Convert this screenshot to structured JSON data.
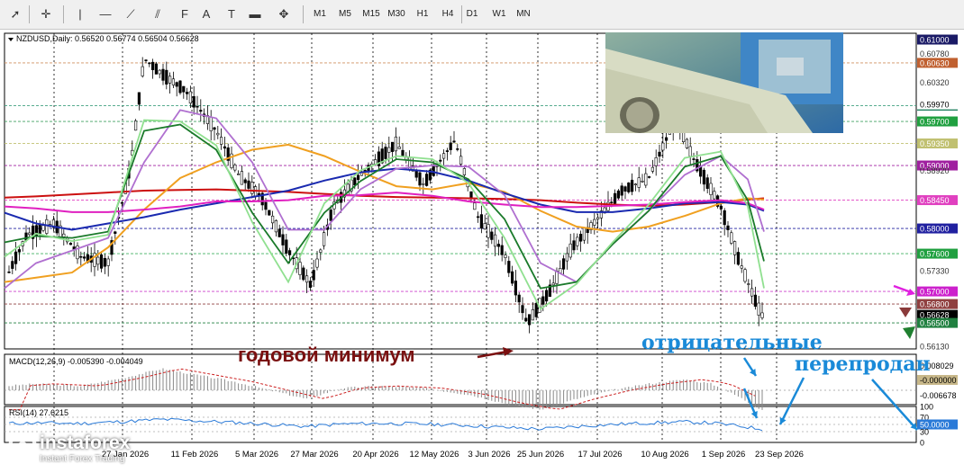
{
  "toolbar": {
    "timeframes": [
      "M1",
      "M5",
      "M15",
      "M30",
      "H1",
      "H4",
      "D1",
      "W1",
      "MN"
    ],
    "tools": [
      {
        "icon": "cursor-icon",
        "glyph": "➚"
      },
      {
        "icon": "crosshair-icon",
        "glyph": "✛"
      },
      {
        "icon": "vertical-line-icon",
        "glyph": "|"
      },
      {
        "icon": "horizontal-line-icon",
        "glyph": "—"
      },
      {
        "icon": "trendline-icon",
        "glyph": "⟋"
      },
      {
        "icon": "equidistant-channel-icon",
        "glyph": "⫽"
      },
      {
        "icon": "fibonacci-icon",
        "glyph": "F"
      },
      {
        "icon": "text-icon",
        "glyph": "A"
      },
      {
        "icon": "text-label-icon",
        "glyph": "T"
      },
      {
        "icon": "rectangle-label-icon",
        "glyph": "▬"
      },
      {
        "icon": "arrows-shapes-icon",
        "glyph": "✥"
      }
    ]
  },
  "chart_data": [
    {
      "type": "candlestick",
      "title": "NZDUSD,Daily:  0.56520 0.56774 0.56504 0.56628",
      "ylim": [
        0.5613,
        0.61
      ],
      "x_tick_labels": [
        "27 Jan 2026",
        "11 Feb 2026",
        "5 Mar 2026",
        "27 Mar 2026",
        "20 Apr 2026",
        "12 May 2026",
        "3 Jun 2026",
        "25 Jun 2026",
        "17 Jul 2026",
        "10 Aug 2026",
        "1 Sep 2026",
        "23 Sep 2026"
      ],
      "price_levels": [
        {
          "label": "0.61000",
          "price": 0.61,
          "bg": "#1a1a66",
          "line": null
        },
        {
          "label": "0.60780",
          "price": 0.6078,
          "bg": null,
          "line": null
        },
        {
          "label": "0.60630",
          "price": 0.6063,
          "bg": "#c06030",
          "line": "#d09060"
        },
        {
          "label": "0.60320",
          "price": 0.6032,
          "bg": null,
          "line": null
        },
        {
          "label": "0.59950",
          "price": 0.5995,
          "bg": "#208060",
          "line": "#40a080"
        },
        {
          "label": "0.59970",
          "price": 0.5997,
          "bg": "#ffffff",
          "line": null
        },
        {
          "label": "0.59700",
          "price": 0.597,
          "bg": "#20a040",
          "line": "#40a060"
        },
        {
          "label": "0.59350",
          "price": 0.5935,
          "bg": "#c0c070",
          "line": "#c0c070"
        },
        {
          "label": "0.59000",
          "price": 0.59,
          "bg": "#a020a0",
          "line": "#a020a0"
        },
        {
          "label": "0.58920",
          "price": 0.5892,
          "bg": null,
          "line": null
        },
        {
          "label": "0.58450",
          "price": 0.5845,
          "bg": "#e040c0",
          "line": "#e040c0"
        },
        {
          "label": "0.58000",
          "price": 0.58,
          "bg": "#2020a0",
          "line": "#2020a0"
        },
        {
          "label": "0.57600",
          "price": 0.576,
          "bg": "#20a040",
          "line": "#40b060"
        },
        {
          "label": "0.57330",
          "price": 0.5733,
          "bg": null,
          "line": null
        },
        {
          "label": "0.57000",
          "price": 0.57,
          "bg": "#cc20cc",
          "line": "#cc40cc"
        },
        {
          "label": "0.56800",
          "price": 0.568,
          "bg": "#904040",
          "line": "#904040"
        },
        {
          "label": "0.56628",
          "price": 0.56628,
          "bg": "#000000",
          "line": null
        },
        {
          "label": "0.56500",
          "price": 0.565,
          "bg": "#208040",
          "line": "#208040"
        },
        {
          "label": "0.56130",
          "price": 0.5613,
          "bg": null,
          "line": null
        }
      ],
      "moving_averages": [
        {
          "color": "#cc1010",
          "values": [
            0.5849,
            0.5851,
            0.5854,
            0.5857,
            0.586,
            0.5861,
            0.5862,
            0.586,
            0.5858,
            0.5855,
            0.5852,
            0.585,
            0.5849,
            0.5848,
            0.5847,
            0.5845,
            0.5841,
            0.5838,
            0.5836,
            0.5838,
            0.5842,
            0.5846,
            0.5848
          ]
        },
        {
          "color": "#f0a020",
          "values": [
            0.5715,
            0.5722,
            0.573,
            0.577,
            0.583,
            0.588,
            0.5905,
            0.5925,
            0.5933,
            0.5915,
            0.589,
            0.5867,
            0.5862,
            0.5872,
            0.5858,
            0.5828,
            0.5803,
            0.5795,
            0.5803,
            0.582,
            0.584,
            0.5848,
            0.5846
          ]
        },
        {
          "color": "#1a2ab0",
          "values": [
            0.5825,
            0.5808,
            0.5798,
            0.5808,
            0.5818,
            0.583,
            0.584,
            0.585,
            0.586,
            0.5876,
            0.5889,
            0.5895,
            0.589,
            0.5876,
            0.5856,
            0.5838,
            0.5826,
            0.5826,
            0.5832,
            0.584,
            0.5842,
            0.5838,
            0.5828
          ]
        },
        {
          "color": "#e020c0",
          "values": [
            0.5835,
            0.5832,
            0.5826,
            0.5826,
            0.583,
            0.5835,
            0.5843,
            0.5843,
            0.5845,
            0.5852,
            0.5853,
            0.5857,
            0.5852,
            0.5843,
            0.5838,
            0.5834,
            0.5834,
            0.5836,
            0.5838,
            0.5842,
            0.5845,
            0.584,
            0.583
          ]
        },
        {
          "color": "#b070d0",
          "values": [
            0.5705,
            0.5745,
            0.5765,
            0.5785,
            0.5905,
            0.5988,
            0.5975,
            0.5905,
            0.5798,
            0.5798,
            0.5862,
            0.5895,
            0.59,
            0.5898,
            0.5853,
            0.5745,
            0.5715,
            0.5775,
            0.5828,
            0.5885,
            0.5915,
            0.5878,
            0.5795
          ]
        },
        {
          "color": "#1a7a2a",
          "values": [
            0.5778,
            0.5788,
            0.5785,
            0.5795,
            0.5955,
            0.5965,
            0.5925,
            0.5825,
            0.5745,
            0.5825,
            0.5875,
            0.591,
            0.5905,
            0.5878,
            0.5815,
            0.5705,
            0.5715,
            0.5775,
            0.5828,
            0.5898,
            0.5915,
            0.5845,
            0.5748
          ]
        },
        {
          "color": "#90e090",
          "values": [
            0.5755,
            0.5792,
            0.578,
            0.579,
            0.5972,
            0.597,
            0.5932,
            0.581,
            0.5715,
            0.584,
            0.5892,
            0.5915,
            0.591,
            0.5872,
            0.5785,
            0.5672,
            0.5712,
            0.5778,
            0.5838,
            0.5912,
            0.5922,
            0.5835,
            0.5705
          ]
        }
      ],
      "annotations": [
        {
          "text": "годовой минимум",
          "color": "#7a1010"
        }
      ]
    },
    {
      "type": "histogram",
      "title": "MACD(12,26,9) -0.005390 -0.004049",
      "axis_labels": [
        "0.008029",
        "-0.000000",
        "-0.006678"
      ],
      "ylim": [
        -0.006678,
        0.008029
      ]
    },
    {
      "type": "line",
      "title": "RSI(14) 27.6215",
      "axis_labels": [
        "100",
        "70",
        "50.0000",
        "30",
        "0"
      ],
      "ylim": [
        0,
        100
      ],
      "levels": [
        70,
        50,
        30
      ],
      "current_value": 27.6215
    }
  ],
  "annotations": {
    "negative": "отрицательные",
    "oversold": "перепродан"
  },
  "logo": {
    "brand": "instaforex",
    "tagline": "Instant Forex Trading"
  },
  "colors": {
    "accent_blue": "#1a8ad8",
    "candle": "#000000",
    "bg": "#ffffff"
  }
}
